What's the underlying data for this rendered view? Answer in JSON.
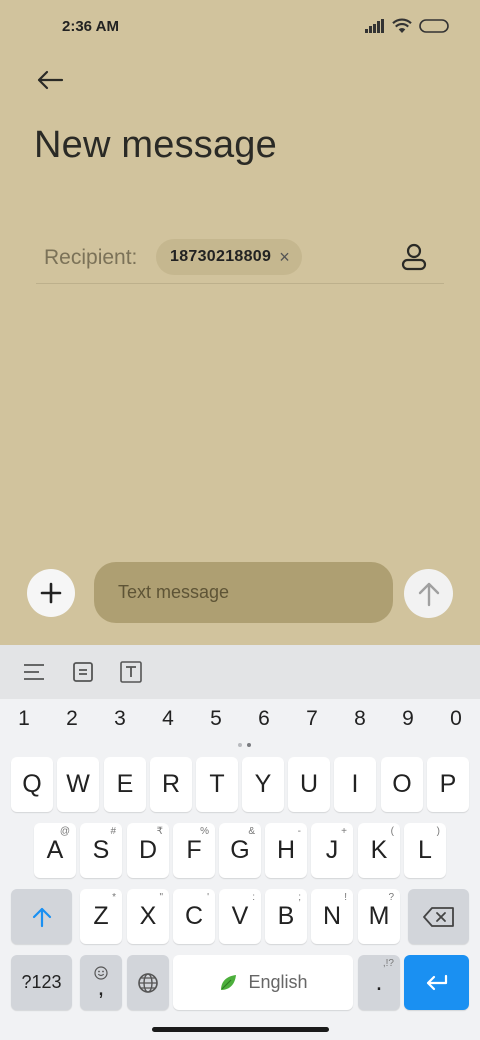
{
  "status_bar": {
    "time": "2:36 AM"
  },
  "header": {
    "title": "New message"
  },
  "recipient": {
    "label": "Recipient:",
    "chip_text": "18730218809",
    "chip_remove": "×"
  },
  "composer": {
    "placeholder": "Text message"
  },
  "keyboard": {
    "numbers": [
      "1",
      "2",
      "3",
      "4",
      "5",
      "6",
      "7",
      "8",
      "9",
      "0"
    ],
    "row1": [
      "Q",
      "W",
      "E",
      "R",
      "T",
      "Y",
      "U",
      "I",
      "O",
      "P"
    ],
    "row2": [
      "A",
      "S",
      "D",
      "F",
      "G",
      "H",
      "J",
      "K",
      "L"
    ],
    "row2_sub": [
      "@",
      "#",
      "₹",
      "%",
      "&",
      "-",
      "+",
      "(",
      ")"
    ],
    "row3": [
      "Z",
      "X",
      "C",
      "V",
      "B",
      "N",
      "M"
    ],
    "row3_sub": [
      "*",
      "\"",
      "'",
      ":",
      ";",
      "!",
      "?"
    ],
    "symbols_label": "?123",
    "comma_label": ",",
    "space_label": "English",
    "period_label": ".",
    "period_sub": ",!?"
  }
}
